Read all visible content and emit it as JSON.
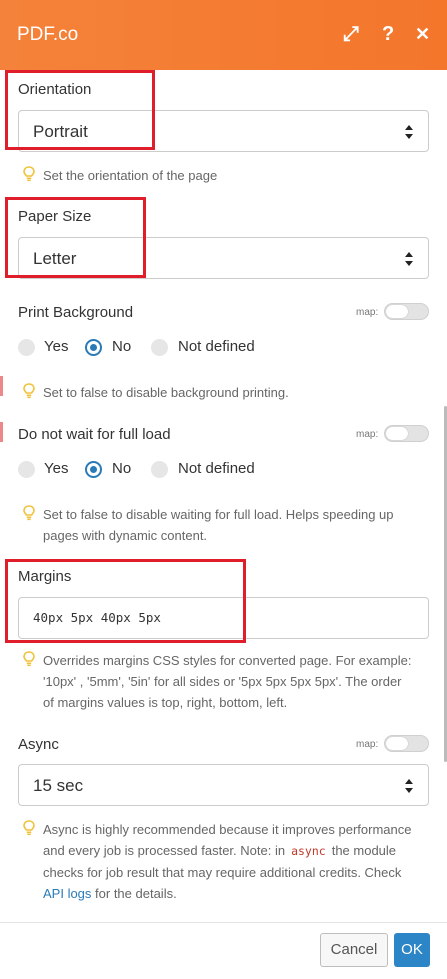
{
  "header": {
    "title": "PDF.co",
    "icons": [
      "expand-icon",
      "help-icon",
      "close-icon"
    ]
  },
  "orientation": {
    "label": "Orientation",
    "value": "Portrait",
    "hint": "Set the orientation of the page"
  },
  "paper_size": {
    "label": "Paper Size",
    "value": "Letter"
  },
  "print_background": {
    "label": "Print Background",
    "map_label": "map:",
    "options": [
      "Yes",
      "No",
      "Not defined"
    ],
    "selected": "No",
    "hint": "Set to false to disable background printing."
  },
  "full_load": {
    "label": "Do not wait for full load",
    "map_label": "map:",
    "options": [
      "Yes",
      "No",
      "Not defined"
    ],
    "selected": "No",
    "hint_line1": "Set to false to disable waiting for full load. Helps speeding up",
    "hint_line2": "pages with dynamic content."
  },
  "margins": {
    "label": "Margins",
    "value": "40px 5px 40px 5px",
    "hint_line1": "Overrides margins CSS styles for converted page. For example:",
    "hint_line2": "'10px' , '5mm', '5in' for all sides or '5px 5px 5px 5px'. The order",
    "hint_line3": "of margins values is top, right, bottom, left."
  },
  "async": {
    "label": "Async",
    "map_label": "map:",
    "value": "15 sec",
    "hint_line1": "Async is highly recommended because it improves performance",
    "hint_line2_a": "and every job is processed faster. Note: in",
    "hint_code": "async",
    "hint_line2_b": "the module",
    "hint_line3": "checks for job result that may require additional credits. Check",
    "hint_link": "API logs",
    "hint_line4_b": " for the details."
  },
  "footer": {
    "cancel_label": "Cancel",
    "ok_label": "OK"
  },
  "colors": {
    "header": "#f5823a",
    "accent": "#2a7ab8",
    "highlight": "#e01e2b"
  }
}
